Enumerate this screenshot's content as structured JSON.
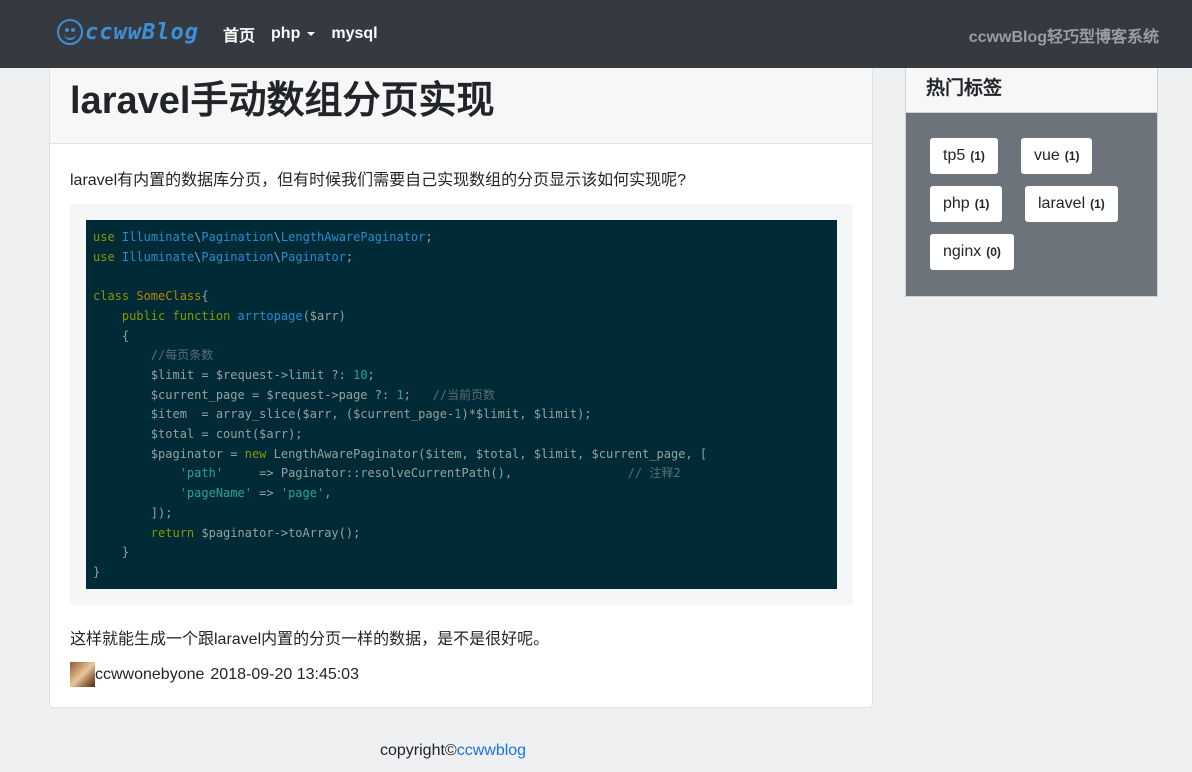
{
  "navbar": {
    "brand": "ccwwBlog",
    "links": [
      {
        "label": "首页"
      },
      {
        "label": "php"
      },
      {
        "label": "mysql"
      }
    ],
    "tagline": "ccwwBlog轻巧型博客系统"
  },
  "article": {
    "title": "laravel手动数组分页实现",
    "intro": "laravel有内置的数据库分页，但有时候我们需要自己实现数组的分页显示该如何实现呢?",
    "code_lines": [
      "use Illuminate\\Pagination\\LengthAwarePaginator;",
      "use Illuminate\\Pagination\\Paginator;",
      "",
      "class SomeClass{",
      "    public function arrtopage($arr)",
      "    {",
      "        //每页条数",
      "        $limit = $request->limit ?: 10;",
      "        $current_page = $request->page ?: 1;   //当前页数",
      "        $item  = array_slice($arr, ($current_page-1)*$limit, $limit);",
      "        $total = count($arr);",
      "        $paginator = new LengthAwarePaginator($item, $total, $limit, $current_page, [",
      "            'path'     => Paginator::resolveCurrentPath(),                // 注释2",
      "            'pageName' => 'page',",
      "        ]);",
      "        return $paginator->toArray();",
      "    }",
      "}"
    ],
    "conclusion": "这样就能生成一个跟laravel内置的分页一样的数据，是不是很好呢。",
    "author": "ccwwonebyone",
    "timestamp": "2018-09-20 13:45:03"
  },
  "sidebar": {
    "title": "热门标签",
    "tags": [
      {
        "name": "tp5",
        "count": "(1)"
      },
      {
        "name": "vue",
        "count": "(1)"
      },
      {
        "name": "php",
        "count": "(1)"
      },
      {
        "name": "laravel",
        "count": "(1)"
      },
      {
        "name": "nginx",
        "count": "(0)"
      }
    ]
  },
  "footer": {
    "prefix": "copyright©",
    "link": "ccwwblog"
  },
  "colors": {
    "navbar_bg": "#343a40",
    "brand": "#3d8fd6",
    "code_bg": "#002b36",
    "sidebar_body": "#6c737b",
    "link": "#1a73e8"
  }
}
